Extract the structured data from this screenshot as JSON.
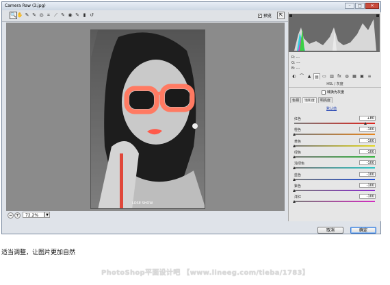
{
  "window": {
    "title": "Camera Raw (3.jpg)",
    "controls": [
      "–",
      "□",
      "✕"
    ]
  },
  "toolbar": {
    "tools": [
      {
        "name": "zoom-tool-icon",
        "glyph": "🔍"
      },
      {
        "name": "hand-tool-icon",
        "glyph": "✋"
      },
      {
        "name": "white-balance-tool-icon",
        "glyph": "✎"
      },
      {
        "name": "color-sampler-tool-icon",
        "glyph": "✎"
      },
      {
        "name": "targeted-adjustment-tool-icon",
        "glyph": "◎"
      },
      {
        "name": "crop-tool-icon",
        "glyph": "⌗"
      },
      {
        "name": "straighten-tool-icon",
        "glyph": "⟋"
      },
      {
        "name": "spot-removal-tool-icon",
        "glyph": "✎"
      },
      {
        "name": "red-eye-tool-icon",
        "glyph": "◉"
      },
      {
        "name": "adjustment-brush-icon",
        "glyph": "✎"
      },
      {
        "name": "graduated-filter-icon",
        "glyph": "▮"
      },
      {
        "name": "rotate-icon",
        "glyph": "↺"
      }
    ],
    "preview_label": "预览",
    "preview_checked": true
  },
  "image": {
    "caption": "LOSE SHOW"
  },
  "zoom": {
    "value": "72.2%"
  },
  "panel": {
    "rgb": {
      "r": "R:   ---",
      "g": "G:   ---",
      "b": "B:   ---"
    },
    "section_title": "HSL / 灰度",
    "convert_gray_label": "转换为灰度",
    "subtabs": [
      "色相",
      "饱和度",
      "明亮度"
    ],
    "selected_subtab": 1,
    "default_link": "默认值",
    "sliders": [
      {
        "label": "红色",
        "value": "+80",
        "fraction": 0.9,
        "gradient": [
          "#7a7a7a",
          "#e0241c"
        ]
      },
      {
        "label": "橙色",
        "value": "-100",
        "fraction": 0.0,
        "gradient": [
          "#7a7a7a",
          "#e8861c"
        ]
      },
      {
        "label": "黄色",
        "value": "-100",
        "fraction": 0.0,
        "gradient": [
          "#7a7a7a",
          "#e4d81e"
        ]
      },
      {
        "label": "绿色",
        "value": "-100",
        "fraction": 0.0,
        "gradient": [
          "#7a7a7a",
          "#2fb33a"
        ]
      },
      {
        "label": "浅绿色",
        "value": "-100",
        "fraction": 0.0,
        "gradient": [
          "#7a7a7a",
          "#2ec6c6"
        ]
      },
      {
        "label": "蓝色",
        "value": "-100",
        "fraction": 0.0,
        "gradient": [
          "#7a7a7a",
          "#2050d8"
        ]
      },
      {
        "label": "紫色",
        "value": "-100",
        "fraction": 0.0,
        "gradient": [
          "#7a7a7a",
          "#8a2ad0"
        ]
      },
      {
        "label": "洋红",
        "value": "-100",
        "fraction": 0.0,
        "gradient": [
          "#7a7a7a",
          "#d22cc0"
        ]
      }
    ]
  },
  "buttons": {
    "cancel": "取消",
    "ok": "确定"
  },
  "tip_text": "适当调整，让图片更加自然",
  "watermark": "PhotoShop平面设计吧 【www.lineeg.com/tieba/1783】"
}
